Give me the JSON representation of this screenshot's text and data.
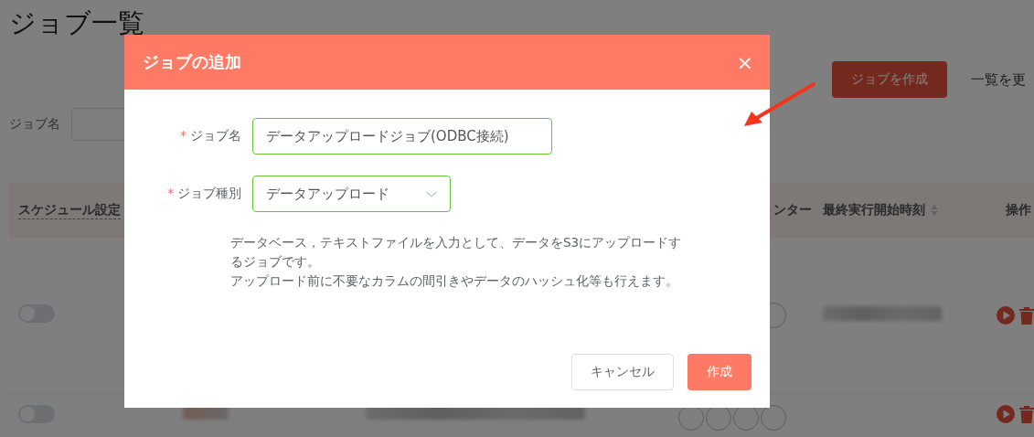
{
  "page": {
    "title": "ジョブ一覧",
    "create_button": "ジョブを作成",
    "refresh_link": "一覧を更",
    "filter_label": "ジョブ名"
  },
  "table": {
    "columns": [
      {
        "label": "スケジュール設定",
        "kind": "dashed"
      },
      {
        "label": "ンター",
        "kind": "plain"
      },
      {
        "label": "最終実行開始時刻",
        "kind": "sortable"
      },
      {
        "label": "操作",
        "kind": "plain"
      }
    ],
    "rows": [
      {
        "schedule_on": false
      },
      {
        "schedule_on": false
      }
    ]
  },
  "dialog": {
    "title": "ジョブの追加",
    "close": "×",
    "fields": [
      {
        "kind": "input",
        "label": "ジョブ名",
        "required_mark": "*",
        "value": "データアップロードジョブ(ODBC接続)"
      },
      {
        "kind": "select",
        "label": "ジョブ種別",
        "required_mark": "*",
        "value": "データアップロード"
      }
    ],
    "description": [
      "データベース，テキストファイルを入力として、データをS3にアップロードするジョブです。",
      "アップロード前に不要なカラムの間引きやデータのハッシュ化等も行えます。"
    ],
    "buttons": [
      {
        "label": "キャンセル",
        "kind": "secondary"
      },
      {
        "label": "作成",
        "kind": "primary"
      }
    ]
  }
}
